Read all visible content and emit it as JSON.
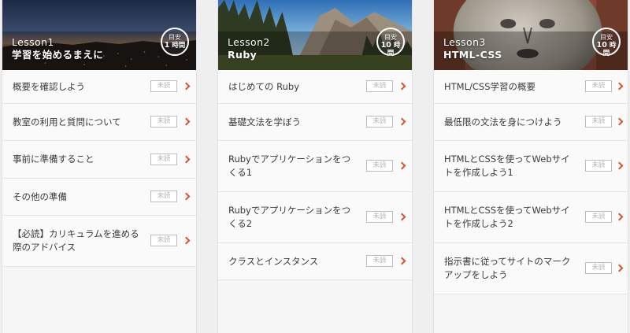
{
  "columns": [
    {
      "lesson": "Lesson1",
      "subtitle": "学習を始めるまえに",
      "badge_top": "目安",
      "badge_num": "1",
      "badge_unit": "時間",
      "items": [
        {
          "label": "概要を確認しよう",
          "status": "未読"
        },
        {
          "label": "教室の利用と質問について",
          "status": "未読"
        },
        {
          "label": "事前に準備すること",
          "status": "未読"
        },
        {
          "label": "その他の準備",
          "status": "未読"
        },
        {
          "label": "【必読】カリキュラムを進める際のアドバイス",
          "status": "未読"
        }
      ]
    },
    {
      "lesson": "Lesson2",
      "subtitle": "Ruby",
      "badge_top": "目安",
      "badge_num": "10",
      "badge_unit": "時間",
      "items": [
        {
          "label": "はじめての Ruby",
          "status": "未読"
        },
        {
          "label": "基礎文法を学ぼう",
          "status": "未読"
        },
        {
          "label": "Rubyでアプリケーションをつくる1",
          "status": "未読"
        },
        {
          "label": "Rubyでアプリケーションをつくる2",
          "status": "未読"
        },
        {
          "label": "クラスとインスタンス",
          "status": "未読"
        }
      ]
    },
    {
      "lesson": "Lesson3",
      "subtitle": "HTML-CSS",
      "badge_top": "目安",
      "badge_num": "10",
      "badge_unit": "時間",
      "items": [
        {
          "label": "HTML/CSS学習の概要",
          "status": "未読"
        },
        {
          "label": "最低限の文法を身につけよう",
          "status": "未読"
        },
        {
          "label": "HTMLとCSSを使ってWebサイトを作成しよう1",
          "status": "未読"
        },
        {
          "label": "HTMLとCSSを使ってWebサイトを作成しよう2",
          "status": "未読"
        },
        {
          "label": "指示書に従ってサイトのマークアップをしよう",
          "status": "未読"
        }
      ]
    }
  ],
  "colors": {
    "arrow": "#d9532f",
    "status_border": "#bdbdbd",
    "status_text": "#b3b3b3"
  },
  "icons": [
    "chevron-right-icon"
  ]
}
